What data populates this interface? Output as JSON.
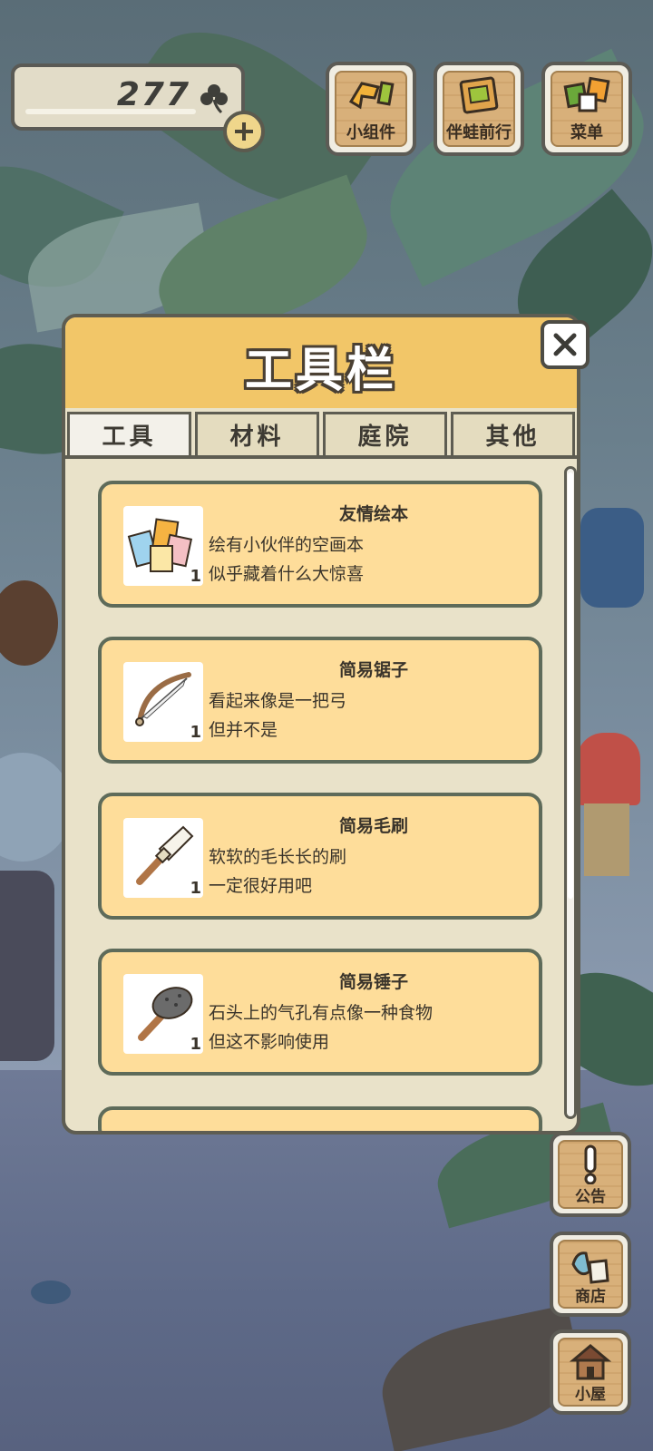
{
  "currency": {
    "amount": "277",
    "icon": "clover-icon",
    "add_icon": "plus-icon"
  },
  "top_buttons": [
    {
      "label": "小组件",
      "icon": "widget-icon"
    },
    {
      "label": "伴蛙前行",
      "icon": "frog-album-icon"
    },
    {
      "label": "菜单",
      "icon": "menu-cards-icon"
    }
  ],
  "side_buttons": [
    {
      "label": "公告",
      "icon": "exclamation-icon"
    },
    {
      "label": "商店",
      "icon": "shop-bags-icon"
    },
    {
      "label": "小屋",
      "icon": "house-icon"
    }
  ],
  "panel": {
    "title": "工具栏",
    "close_icon": "close-icon",
    "tabs": [
      {
        "label": "工具",
        "active": true
      },
      {
        "label": "材料",
        "active": false
      },
      {
        "label": "庭院",
        "active": false
      },
      {
        "label": "其他",
        "active": false
      }
    ],
    "items": [
      {
        "name": "友情绘本",
        "line1": "绘有小伙伴的空画本",
        "line2": "似乎藏着什么大惊喜",
        "qty": "1",
        "icon": "picture-book-icon"
      },
      {
        "name": "简易锯子",
        "line1": "看起来像是一把弓",
        "line2": "但并不是",
        "qty": "1",
        "icon": "saw-icon"
      },
      {
        "name": "简易毛刷",
        "line1": "软软的毛长长的刷",
        "line2": "一定很好用吧",
        "qty": "1",
        "icon": "brush-icon"
      },
      {
        "name": "简易锤子",
        "line1": "石头上的气孔有点像一种食物",
        "line2": "但这不影响使用",
        "qty": "1",
        "icon": "hammer-icon"
      }
    ]
  },
  "colors": {
    "panel_header": "#f2c668",
    "card_bg": "#fedd9a",
    "panel_bg": "#e9e2c9",
    "outline": "#5e5d52"
  }
}
